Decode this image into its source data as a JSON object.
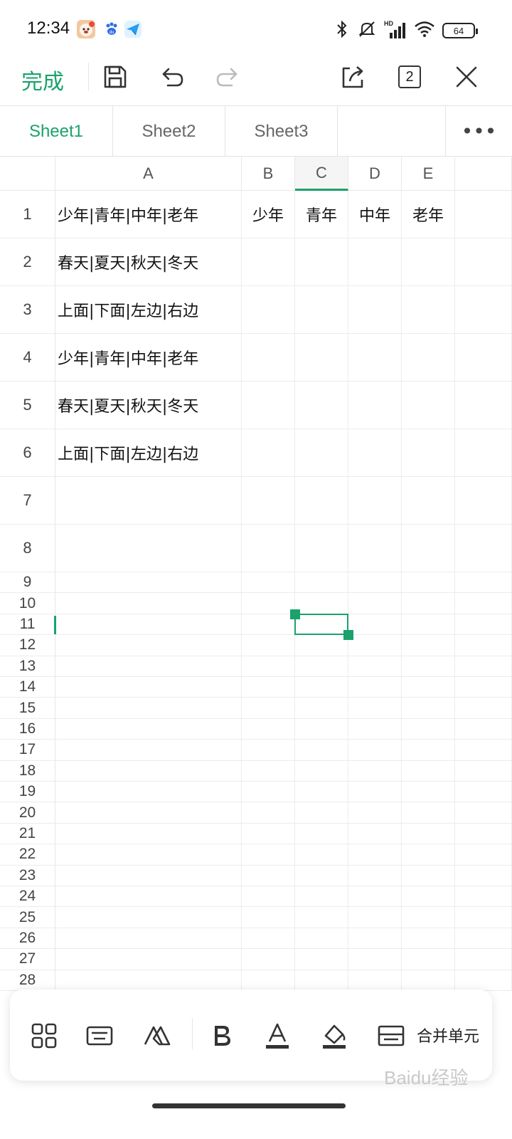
{
  "status_bar": {
    "time": "12:34",
    "battery": "64",
    "app_icons": [
      "dog-app-icon",
      "baidu-paw-icon",
      "paper-plane-app-icon"
    ],
    "indicators": [
      "bluetooth-icon",
      "mute-icon",
      "hd-signal-icon",
      "wifi-icon",
      "battery-icon"
    ],
    "hd_label": "HD"
  },
  "toolbar": {
    "done_label": "完成",
    "window_count": "2",
    "accent_color": "#1aa26b"
  },
  "sheet_tabs": {
    "tabs": [
      "Sheet1",
      "Sheet2",
      "Sheet3"
    ],
    "active": "Sheet1",
    "more": "•••"
  },
  "grid": {
    "columns": [
      "A",
      "B",
      "C",
      "D",
      "E"
    ],
    "selected_column": "C",
    "row_numbers": [
      "1",
      "2",
      "3",
      "4",
      "5",
      "6",
      "7",
      "8",
      "9",
      "10",
      "11",
      "12",
      "13",
      "14",
      "15",
      "16",
      "17",
      "18",
      "19",
      "20",
      "21",
      "22",
      "23",
      "24",
      "25",
      "26",
      "27",
      "28"
    ],
    "selected_cell": "C11",
    "cells": {
      "A1": "少年|青年|中年|老年",
      "B1": "少年",
      "C1": "青年",
      "D1": "中年",
      "E1": "老年",
      "A2": "春天|夏天|秋天|冬天",
      "A3": "上面|下面|左边|右边",
      "A4": "少年|青年|中年|老年",
      "A5": "春天|夏天|秋天|冬天",
      "A6": "上面|下面|左边|右边"
    }
  },
  "bottom_toolbar": {
    "items": [
      "grid-view-icon",
      "keyboard-icon",
      "clear-format-icon",
      "bold-icon",
      "font-color-icon",
      "fill-color-icon",
      "merge-cells-icon"
    ],
    "merge_label": "合并单元"
  },
  "watermark": "Baidu经验"
}
